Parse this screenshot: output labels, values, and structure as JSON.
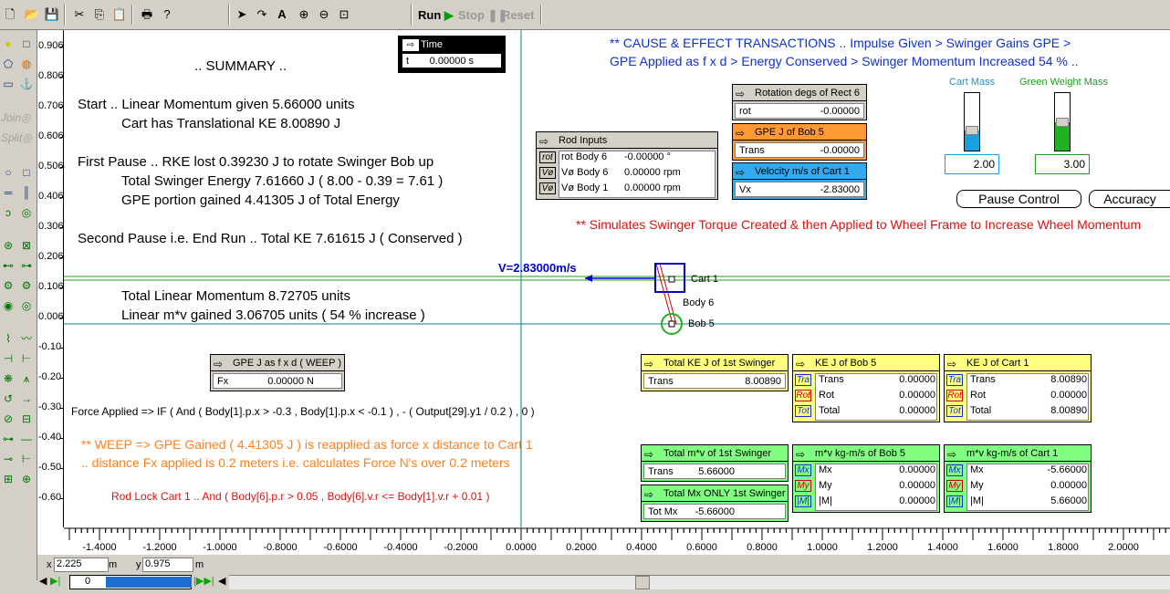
{
  "toolbar": {
    "run": "Run",
    "stop": "Stop",
    "reset": "Reset",
    "icons": [
      "new-icon",
      "open-icon",
      "save-icon",
      "cut-icon",
      "copy-icon",
      "paste-icon",
      "print-icon",
      "help-icon",
      "pointer-icon",
      "rotate-icon",
      "text-icon",
      "zoom-in-icon",
      "zoom-out-icon",
      "zoom-fit-icon"
    ]
  },
  "lefttools": {
    "join": "Join",
    "split": "Split"
  },
  "summary": {
    "title": ".. SUMMARY ..",
    "line1": "Start .. Linear Momentum given 5.66000 units",
    "line2": "Cart has Translational KE 8.00890 J",
    "line3": "First Pause .. RKE lost 0.39230 J to rotate Swinger Bob up",
    "line4": "Total Swinger Energy 7.61660 J  ( 8.00 - 0.39 = 7.61 )",
    "line5": "GPE portion gained 4.41305 J of Total Energy",
    "line6": "Second Pause i.e. End Run .. Total KE 7.61615 J  ( Conserved )",
    "line7": "Total Linear Momentum 8.72705 units",
    "line8": "Linear m*v gained 3.06705 units  ( 54 % increase )"
  },
  "cause": {
    "line1": "** CAUSE & EFFECT TRANSACTIONS .. Impulse Given > Swinger Gains GPE >",
    "line2": "GPE Applied as f x d > Energy Conserved > Swinger Momentum Increased 54 % ..",
    "simulates": "** Simulates Swinger Torque Created & then Applied to Wheel Frame to Increase Wheel Momentum"
  },
  "time": {
    "title": "Time",
    "label": "t",
    "value": "0.00000 s"
  },
  "rot6": {
    "title": "Rotation degs of Rect 6",
    "label": "rot",
    "value": "-0.00000"
  },
  "gpe5": {
    "title": "GPE J of Bob 5",
    "label": "Trans",
    "value": "-0.00000"
  },
  "vel1": {
    "title": "Velocity m/s of Cart 1",
    "label": "Vx",
    "value": "-2.83000"
  },
  "rod": {
    "title": "Rod Inputs",
    "side": [
      "rot",
      "Vø",
      "Vø"
    ],
    "labels": [
      "rot Body 6",
      "Vø Body 6",
      "Vø Body 1"
    ],
    "values": [
      "-0.00000 °",
      "0.00000 rpm",
      "0.00000 rpm"
    ]
  },
  "cartmass": {
    "label": "Cart Mass",
    "value": "2.00",
    "level": 0.35
  },
  "greenmass": {
    "label": "Green Weight Mass",
    "value": "3.00",
    "level": 0.5
  },
  "buttons": {
    "pause": "Pause Control",
    "accuracy": "Accuracy"
  },
  "velocity_label": "V=2.83000m/s",
  "bodies": {
    "cart": "Cart 1",
    "rod": "Body 6",
    "bob": "Bob 5"
  },
  "weep": {
    "title": "GPE J as f x d ( WEEP )",
    "label": "Fx",
    "value": "0.00000 N"
  },
  "force_text": "Force Applied => IF ( And ( Body[1].p.x > -0.3 , Body[1].p.x < -0.1 ) , - ( Output[29].y1 / 0.2 ) , 0 )",
  "weep_text1": "** WEEP => GPE Gained  ( 4.41305 J )  is reapplied as force x distance to Cart 1",
  "weep_text2": ".. distance Fx applied is 0.2 meters i.e. calculates Force N's over 0.2 meters",
  "rodlock": "Rod Lock Cart 1 .. And ( Body[6].p.r > 0.05 , Body[6].v.r <= Body[1].v.r + 0.01 )",
  "ke_swinger": {
    "title": "Total KE J of 1st Swinger",
    "label": "Trans",
    "value": "8.00890"
  },
  "ke_bob5": {
    "title": "KE J of Bob 5",
    "side": [
      "Tra",
      "Rot",
      "Tot"
    ],
    "labels": [
      "Trans",
      "Rot",
      "Total"
    ],
    "values": [
      "0.00000",
      "0.00000",
      "0.00000"
    ]
  },
  "ke_cart1": {
    "title": "KE J of Cart 1",
    "side": [
      "Tra",
      "Rot",
      "Tot"
    ],
    "labels": [
      "Trans",
      "Rot",
      "Total"
    ],
    "values": [
      "8.00890",
      "0.00000",
      "8.00890"
    ]
  },
  "mv_swinger": {
    "title": "Total m*v of 1st Swinger",
    "label": "Trans",
    "value": "5.66000"
  },
  "mx_only": {
    "title": "Total Mx ONLY 1st Swinger",
    "label": "Tot Mx",
    "value": "-5.66000"
  },
  "mv_bob5": {
    "title": "m*v kg-m/s of Bob 5",
    "side": [
      "Mx",
      "My",
      "|M|"
    ],
    "labels": [
      "Mx",
      "My",
      "|M|"
    ],
    "values": [
      "0.00000",
      "0.00000",
      "0.00000"
    ]
  },
  "mv_cart1": {
    "title": "m*v kg-m/s of Cart 1",
    "side": [
      "Mx",
      "My",
      "|M|"
    ],
    "labels": [
      "Mx",
      "My",
      "|M|"
    ],
    "values": [
      "-5.66000",
      "0.00000",
      "5.66000"
    ]
  },
  "yticks": [
    "0.906",
    "0.806",
    "0.706",
    "0.606",
    "0.506",
    "0.406",
    "0.306",
    "0.206",
    "0.106",
    "0.006",
    "-0.10",
    "-0.20",
    "-0.30",
    "-0.40",
    "-0.50",
    "-0.60"
  ],
  "xticks": [
    "-1.4000",
    "-1.2000",
    "-1.0000",
    "-0.8000",
    "-0.6000",
    "-0.4000",
    "-0.2000",
    "0.0000",
    "0.2000",
    "0.4000",
    "0.6000",
    "0.8000",
    "1.0000",
    "1.2000",
    "1.4000",
    "1.6000",
    "1.8000",
    "2.0000"
  ],
  "status": {
    "x_label": "x",
    "x_value": "2.225",
    "x_unit": "m",
    "y_label": "y",
    "y_value": "0.975",
    "y_unit": "m",
    "frame": "0"
  },
  "colors": {
    "blue_text": "#1030d0",
    "orange_text": "#ff8020",
    "red_text": "#e01010",
    "yellow_meter": "#ffff80",
    "green_meter": "#80ff80",
    "orange_meter": "#ff9933",
    "blue_meter": "#33aaee"
  }
}
